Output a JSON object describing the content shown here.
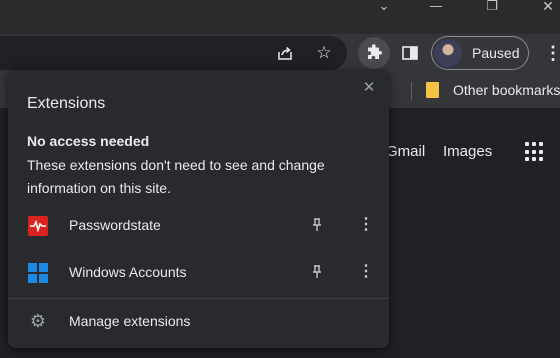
{
  "window": {
    "chevron": "⌄",
    "minimize": "—",
    "maximize": "❐",
    "close": "✕"
  },
  "toolbar": {
    "icons": [
      "share-icon",
      "star-icon",
      "puzzle-icon",
      "side-panel-icon",
      "menu-icon"
    ],
    "star": "☆",
    "profile_status": "Paused",
    "menu": "⋮"
  },
  "bookmarks_bar": {
    "other_bookmarks": "Other bookmarks"
  },
  "page": {
    "gmail": "Gmail",
    "images": "Images"
  },
  "extensions_popup": {
    "title": "Extensions",
    "close": "✕",
    "section_heading": "No access needed",
    "section_description": "These extensions don't need to see and change information on this site.",
    "extensions": [
      {
        "name": "Passwordstate",
        "icon": "passwordstate-icon",
        "more": "⋮"
      },
      {
        "name": "Windows Accounts",
        "icon": "windows-accounts-icon",
        "more": "⋮"
      }
    ],
    "manage_label": "Manage extensions",
    "gear": "⚙"
  },
  "colors": {
    "popup_background": "#292a2d",
    "toolbar_background": "#35363a",
    "page_background": "#202124",
    "passwordstate_red": "#d9231e",
    "windows_blue": "#1e88e5",
    "bookmark_folder": "#f6c344"
  }
}
